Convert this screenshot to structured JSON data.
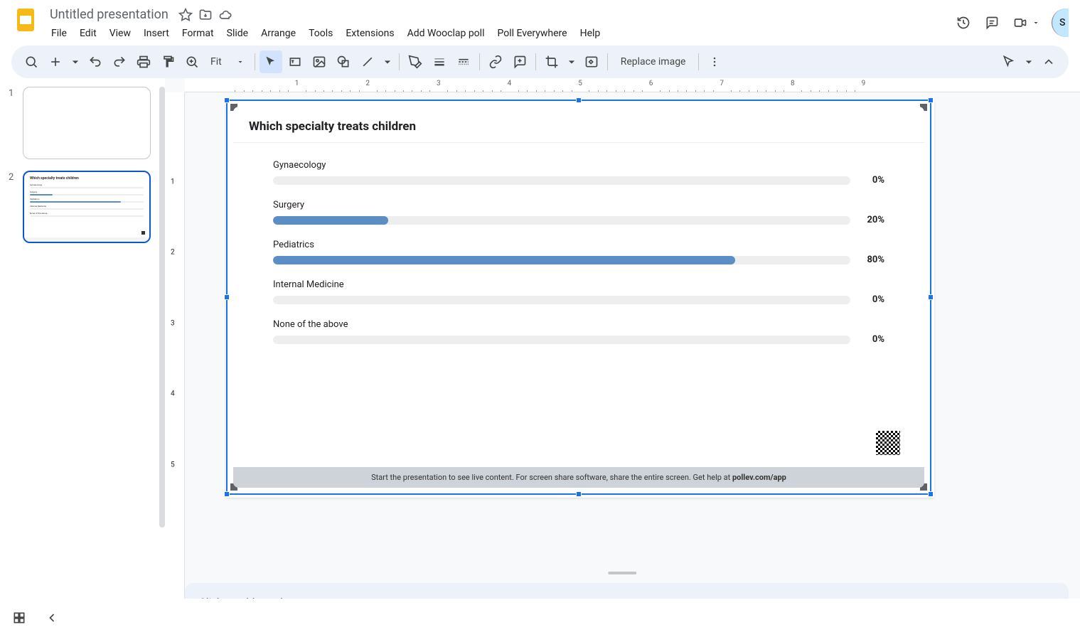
{
  "doc": {
    "title": "Untitled presentation"
  },
  "menus": [
    "File",
    "Edit",
    "View",
    "Insert",
    "Format",
    "Slide",
    "Arrange",
    "Tools",
    "Extensions",
    "Add Wooclap poll",
    "Poll Everywhere",
    "Help"
  ],
  "toolbar": {
    "zoom": "Fit",
    "replace_image": "Replace image"
  },
  "share_crop": "S",
  "ruler": {
    "h": [
      "1",
      "2",
      "3",
      "4",
      "5",
      "6",
      "7",
      "8",
      "9"
    ],
    "v": [
      "1",
      "2",
      "3",
      "4",
      "5"
    ]
  },
  "slides": [
    {
      "num": "1",
      "selected": false
    },
    {
      "num": "2",
      "selected": true
    }
  ],
  "chart_data": {
    "type": "bar",
    "title": "Which specialty treats children",
    "categories": [
      "Gynaecology",
      "Surgery",
      "Pediatrics",
      "Internal Medicine",
      "None of the above"
    ],
    "values": [
      0,
      20,
      80,
      0,
      0
    ],
    "value_labels": [
      "0%",
      "20%",
      "80%",
      "0%",
      "0%"
    ],
    "xlabel": "",
    "ylabel": "",
    "ylim": [
      0,
      100
    ]
  },
  "poll_footer": {
    "pre": "Start the presentation to see live content. For screen share software, share the entire screen. Get help at ",
    "link": "pollev.com/app"
  },
  "notes": {
    "placeholder": "Click to add speaker notes"
  }
}
